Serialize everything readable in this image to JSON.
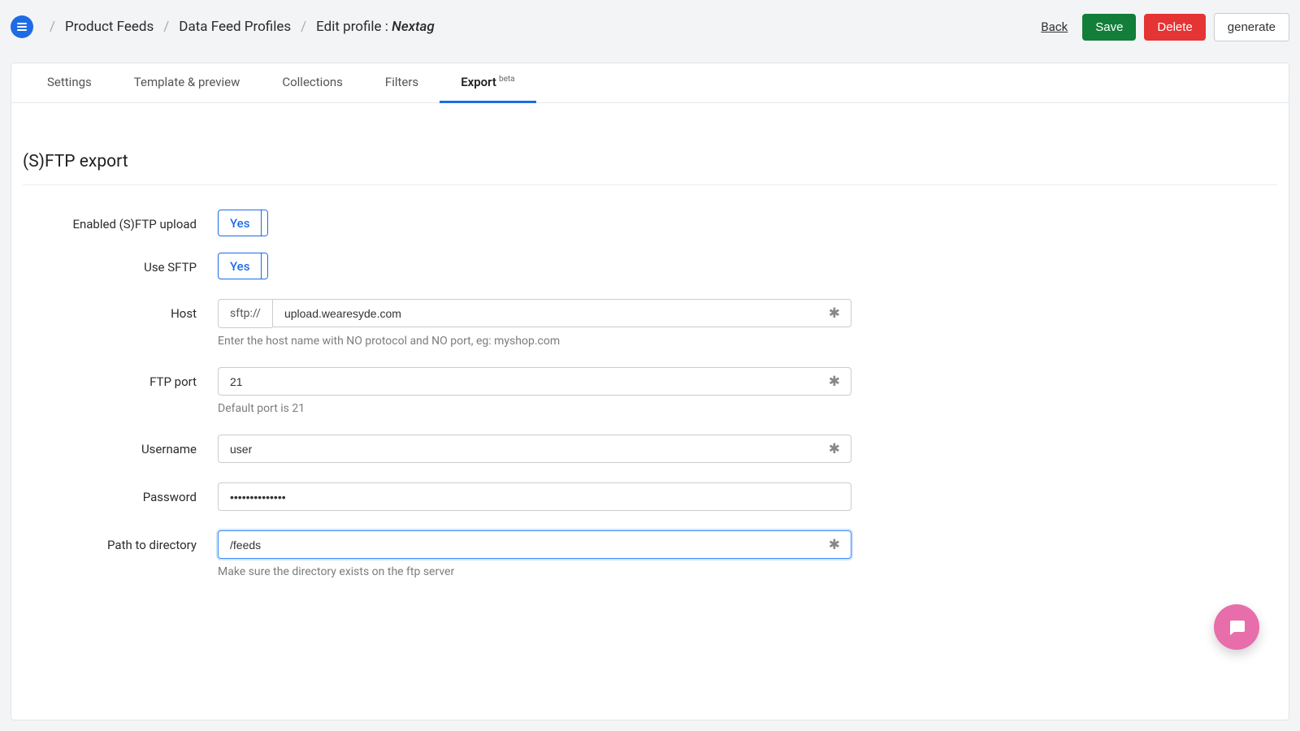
{
  "header": {
    "breadcrumb": {
      "items": [
        "Product Feeds",
        "Data Feed Profiles"
      ],
      "last_label": "Edit profile : ",
      "last_value": "Nextag"
    },
    "back": "Back",
    "save": "Save",
    "delete": "Delete",
    "generate": "generate"
  },
  "tabs": [
    {
      "label": "Settings"
    },
    {
      "label": "Template & preview"
    },
    {
      "label": "Collections"
    },
    {
      "label": "Filters"
    },
    {
      "label": "Export",
      "badge": "beta",
      "active": true
    }
  ],
  "section": {
    "title": "(S)FTP export",
    "fields": {
      "enabled": {
        "label": "Enabled (S)FTP upload",
        "value": "Yes"
      },
      "use_sftp": {
        "label": "Use SFTP",
        "value": "Yes"
      },
      "host": {
        "label": "Host",
        "prefix": "sftp://",
        "value": "upload.wearesyde.com",
        "helper": "Enter the host name with NO protocol and NO port, eg: myshop.com"
      },
      "port": {
        "label": "FTP port",
        "value": "21",
        "helper": "Default port is 21"
      },
      "username": {
        "label": "Username",
        "value": "user"
      },
      "password": {
        "label": "Password",
        "value": "••••••••••••••"
      },
      "path": {
        "label": "Path to directory",
        "value": "/feeds",
        "helper": "Make sure the directory exists on the ftp server"
      }
    }
  }
}
